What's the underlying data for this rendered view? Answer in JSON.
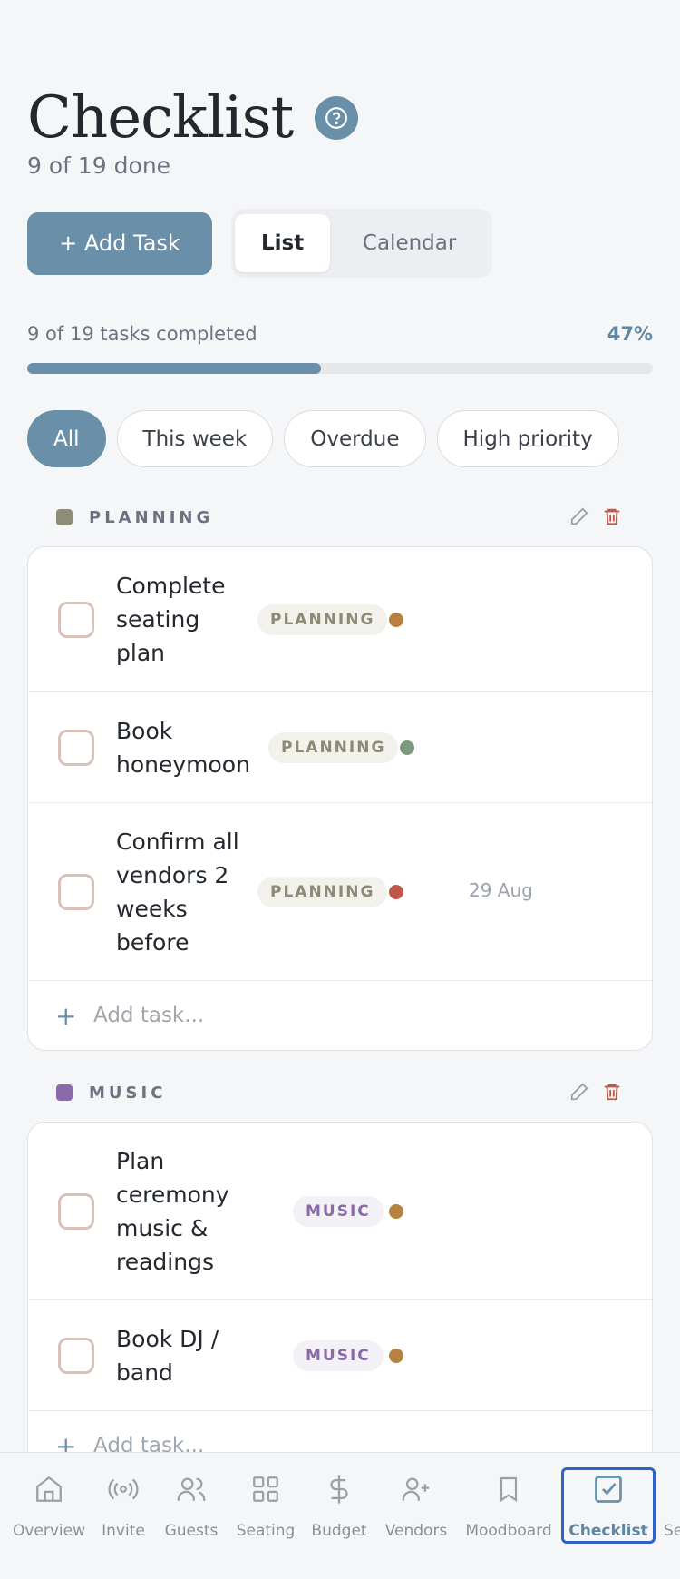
{
  "header": {
    "title": "Checklist",
    "subtitle": "9 of 19 done"
  },
  "actions": {
    "add_task_label": "+ Add Task",
    "view_list": "List",
    "view_calendar": "Calendar"
  },
  "progress": {
    "label": "9 of 19 tasks completed",
    "percent_text": "47%",
    "fraction": 0.47
  },
  "filters": [
    "All",
    "This week",
    "Overdue",
    "High priority"
  ],
  "colors": {
    "accent": "#6a8fa8",
    "planning": "#8c8c78",
    "music": "#8a6aa8",
    "priority_medium": "#b5823f",
    "priority_low": "#7c9a80",
    "priority_high": "#c0574a"
  },
  "sections": [
    {
      "name": "PLANNING",
      "tasks": [
        {
          "title": "Complete seating plan",
          "tag": "PLANNING",
          "priority": "medium",
          "due": ""
        },
        {
          "title": "Book honeymoon",
          "tag": "PLANNING",
          "priority": "low",
          "due": ""
        },
        {
          "title": "Confirm all vendors 2 weeks before",
          "tag": "PLANNING",
          "priority": "high",
          "due": "29 Aug"
        }
      ],
      "add_placeholder": "Add task..."
    },
    {
      "name": "MUSIC",
      "tasks": [
        {
          "title": "Plan ceremony music & readings",
          "tag": "MUSIC",
          "priority": "medium",
          "due": ""
        },
        {
          "title": "Book DJ / band",
          "tag": "MUSIC",
          "priority": "medium",
          "due": ""
        }
      ],
      "add_placeholder": "Add task..."
    }
  ],
  "nav": [
    {
      "label": "Overview",
      "icon": "home-icon"
    },
    {
      "label": "Invite",
      "icon": "broadcast-icon"
    },
    {
      "label": "Guests",
      "icon": "users-icon"
    },
    {
      "label": "Seating",
      "icon": "grid-icon"
    },
    {
      "label": "Budget",
      "icon": "dollar-icon"
    },
    {
      "label": "Vendors",
      "icon": "user-plus-icon"
    },
    {
      "label": "Moodboard",
      "icon": "bookmark-icon"
    },
    {
      "label": "Checklist",
      "icon": "checklist-icon",
      "active": true
    },
    {
      "label": "Se",
      "icon": "settings-icon"
    }
  ]
}
